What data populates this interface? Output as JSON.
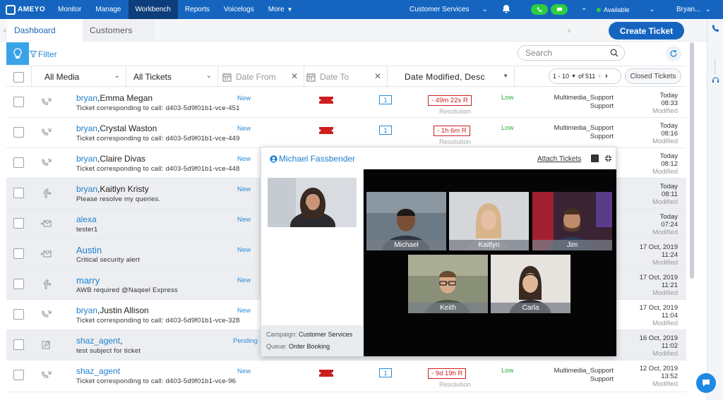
{
  "brand": "AMEYO",
  "nav": [
    {
      "label": "Monitor",
      "active": false
    },
    {
      "label": "Manage",
      "active": false
    },
    {
      "label": "Workbench",
      "active": true
    },
    {
      "label": "Reports",
      "active": false
    },
    {
      "label": "Voicelogs",
      "active": false
    },
    {
      "label": "More",
      "active": false
    }
  ],
  "campaign": "Customer Services",
  "availability": "Available",
  "user": "Bryan...",
  "tabs": {
    "dashboard": "Dashboard",
    "customers": "Customers"
  },
  "create_ticket": "Create Ticket",
  "filter_label": "Filter",
  "search_placeholder": "Search",
  "columns": {
    "media": "All Media",
    "tickets": "All Tickets",
    "date_from": "Date From",
    "date_to": "Date To",
    "sort": "Date Modified, Desc"
  },
  "pager": {
    "range": "1 - 10",
    "of": "of 511"
  },
  "closed_tickets": "Closed Tickets",
  "rows": [
    {
      "user": "bryan",
      "contact": ",Emma Megan",
      "subject": "Ticket corresponding to call: d403-5d9f01b1-vce-451",
      "status": "New",
      "count": "1",
      "sla": "- 49m 22s R",
      "sla_label": "Resolution",
      "priority": "Low",
      "queue1": "Multimedia_Support",
      "queue2": "Support",
      "date": "Today",
      "time": "08:33",
      "mod": "Modified",
      "media": "call"
    },
    {
      "user": "bryan",
      "contact": ",Crystal Waston",
      "subject": "Ticket corresponding to call: d403-5d9f01b1-vce-449",
      "status": "New",
      "count": "1",
      "sla": "- 1h 6m R",
      "sla_label": "Resolution",
      "priority": "Low",
      "queue1": "Multimedia_Support",
      "queue2": "Support",
      "date": "Today",
      "time": "08:16",
      "mod": "Modified",
      "media": "call"
    },
    {
      "user": "bryan",
      "contact": ",Claire Divas",
      "subject": "Ticket corresponding to call: d403-5d9f01b1-vce-448",
      "status": "New",
      "date": "Today",
      "time": "08:12",
      "mod": "Modified",
      "media": "call"
    },
    {
      "user": "bryan",
      "contact": ",Kaitlyn Kristy",
      "subject": "Please resolve my queries.",
      "status": "New",
      "date": "Today",
      "time": "08:11",
      "mod": "Modified",
      "media": "facebook"
    },
    {
      "user": "alexa",
      "contact": "",
      "subject": "tester1",
      "status": "New",
      "date": "Today",
      "time": "07:24",
      "mod": "Modified",
      "media": "email"
    },
    {
      "user": "Austin",
      "contact": "",
      "subject": "Critical security alert",
      "status": "New",
      "date": "17 Oct, 2019",
      "time": "11:24",
      "mod": "Modified",
      "media": "email"
    },
    {
      "user": "marry",
      "contact": "",
      "subject": "AWB required @Naqeel Express",
      "status": "New",
      "date": "17 Oct, 2019",
      "time": "11:21",
      "mod": "Modified",
      "media": "facebook"
    },
    {
      "user": "bryan",
      "contact": ",Justin Allison",
      "subject": "Ticket corresponding to call: d403-5d9f01b1-vce-328",
      "status": "New",
      "date": "17 Oct, 2019",
      "time": "11:04",
      "mod": "Modified",
      "media": "call"
    },
    {
      "user": "shaz_agent",
      "contact": ",",
      "subject": "test subject for ticket",
      "status": "Pending",
      "date": "16 Oct, 2019",
      "time": "11:02",
      "mod": "Modified",
      "media": "edit"
    },
    {
      "user": "shaz_agent",
      "contact": "",
      "subject": "Ticket corresponding to call: d403-5d9f01b1-vce-96",
      "status": "New",
      "count": "1",
      "sla": "- 9d 19h R",
      "sla_label": "Resolution",
      "priority": "Low",
      "queue1": "Multimedia_Support",
      "queue2": "Support",
      "date": "12 Oct, 2019",
      "time": "13:52",
      "mod": "Modified",
      "media": "call"
    }
  ],
  "popup": {
    "title": "Michael Fassbender",
    "attach": "Attach Tickets",
    "campaign_label": "Campaign:",
    "campaign_value": "Customer Services",
    "queue_label": "Queue:",
    "queue_value": "Order Booking",
    "participants": [
      "Michael",
      "Kaitlyn",
      "Jim",
      "Keith",
      "Carla"
    ]
  },
  "colors": {
    "brand": "#1565c0",
    "accent": "#2a8bd6",
    "danger": "#cc1f1f",
    "ok": "#2ecc40"
  }
}
